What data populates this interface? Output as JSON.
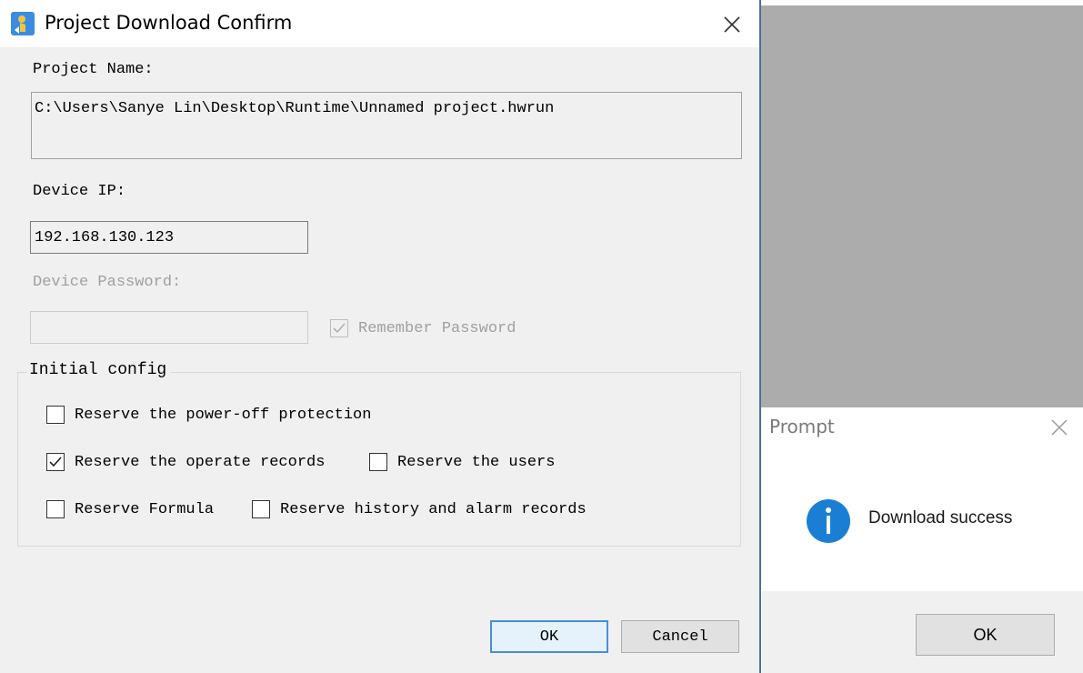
{
  "main_dialog": {
    "title": "Project Download Confirm",
    "project_name_label": "Project Name:",
    "project_path": "C:\\Users\\Sanye Lin\\Desktop\\Runtime\\Unnamed project.hwrun",
    "device_ip_label": "Device IP:",
    "device_ip_value": "192.168.130.123",
    "device_password_label": "Device Password:",
    "device_password_value": "",
    "remember_password": {
      "label": "Remember Password",
      "checked": true,
      "enabled": false
    },
    "initial_config": {
      "title": "Initial config",
      "options": [
        {
          "label": "Reserve the power-off protection",
          "checked": false
        },
        {
          "label": "Reserve the operate records",
          "checked": true
        },
        {
          "label": "Reserve the users",
          "checked": false
        },
        {
          "label": "Reserve Formula",
          "checked": false
        },
        {
          "label": "Reserve history and alarm records",
          "checked": false
        }
      ]
    },
    "ok_label": "OK",
    "cancel_label": "Cancel"
  },
  "prompt_dialog": {
    "title": "Prompt",
    "message": "Download success",
    "ok_label": "OK",
    "icon": "info-icon"
  },
  "colors": {
    "accent": "#1a7fd4",
    "dialog_bg": "#f0f0f0",
    "background_gray": "#acacac"
  }
}
